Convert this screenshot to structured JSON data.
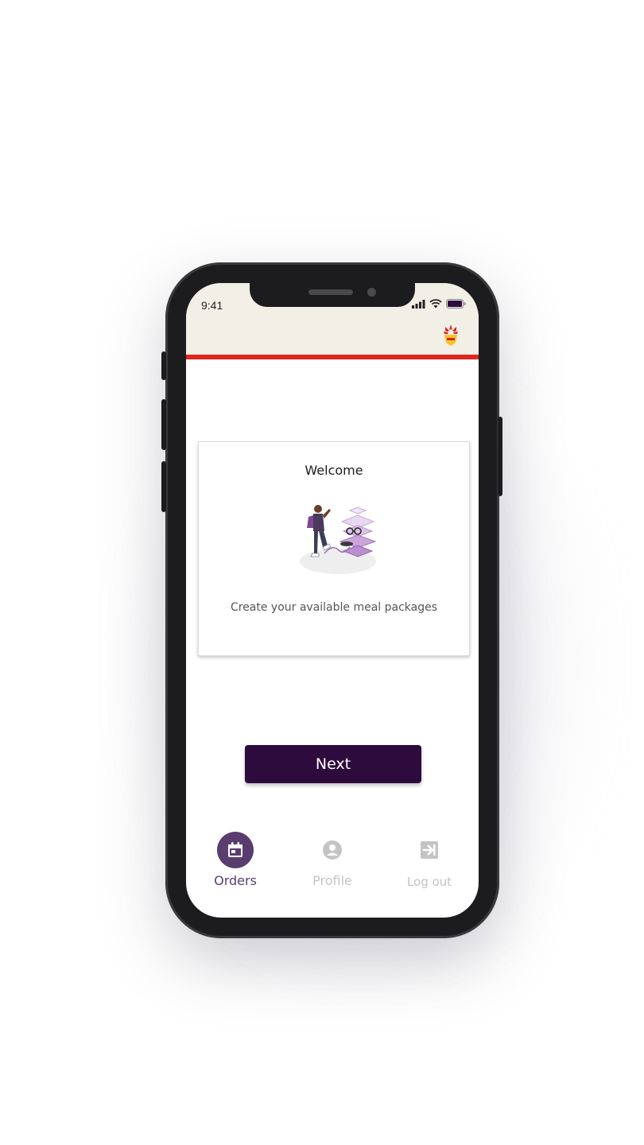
{
  "status_bar": {
    "time": "9:41"
  },
  "welcome_card": {
    "title": "Welcome",
    "description": "Create your available meal packages"
  },
  "actions": {
    "next_label": "Next"
  },
  "bottom_nav": {
    "items": [
      {
        "label": "Orders",
        "icon": "calendar-icon",
        "active": true
      },
      {
        "label": "Profile",
        "icon": "user-icon",
        "active": false
      },
      {
        "label": "Log out",
        "icon": "logout-icon",
        "active": false
      }
    ]
  },
  "colors": {
    "primary": "#2e0b3d",
    "active_nav": "#5a3d6e",
    "inactive_nav": "#c4c4c4",
    "accent_red": "#e0261f",
    "header_bg": "#f2efe6"
  }
}
